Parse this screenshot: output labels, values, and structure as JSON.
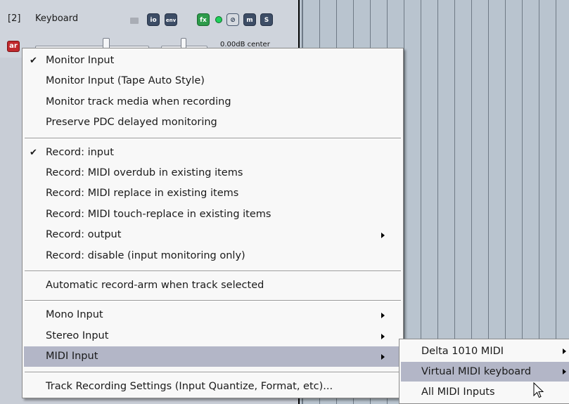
{
  "track": {
    "number": "[2]",
    "name": "Keyboard",
    "buttons": {
      "io": "io",
      "env": "env",
      "fx": "fx",
      "phase": "⊘",
      "mute": "m",
      "solo": "S"
    },
    "arm_label": "ar",
    "vol_pan_readout": "0.00dB center"
  },
  "context_menu": {
    "groups": [
      [
        {
          "label": "Monitor Input",
          "checked": true
        },
        {
          "label": "Monitor Input (Tape Auto Style)"
        },
        {
          "label": "Monitor track media when recording"
        },
        {
          "label": "Preserve PDC delayed monitoring"
        }
      ],
      [
        {
          "label": "Record: input",
          "checked": true
        },
        {
          "label": "Record: MIDI overdub in existing items"
        },
        {
          "label": "Record: MIDI replace in existing items"
        },
        {
          "label": "Record: MIDI touch-replace in existing items"
        },
        {
          "label": "Record: output",
          "submenu": true
        },
        {
          "label": "Record: disable (input monitoring only)"
        }
      ],
      [
        {
          "label": "Automatic record-arm when track selected"
        }
      ],
      [
        {
          "label": "Mono Input",
          "submenu": true
        },
        {
          "label": "Stereo Input",
          "submenu": true
        },
        {
          "label": "MIDI Input",
          "submenu": true,
          "highlighted": true
        }
      ],
      [
        {
          "label": "Track Recording Settings (Input Quantize, Format, etc)..."
        }
      ]
    ],
    "check_glyph": "✔"
  },
  "midi_submenu": {
    "items": [
      {
        "label": "Delta 1010 MIDI",
        "submenu": true
      },
      {
        "label": "Virtual MIDI keyboard",
        "submenu": true,
        "highlighted": true
      },
      {
        "label": "All MIDI Inputs"
      }
    ]
  },
  "colors": {
    "highlight": "#b3b6c7",
    "arm": "#c0282c",
    "fx_active": "#2d9b4a",
    "arrange_bg": "#b9c4cf"
  }
}
